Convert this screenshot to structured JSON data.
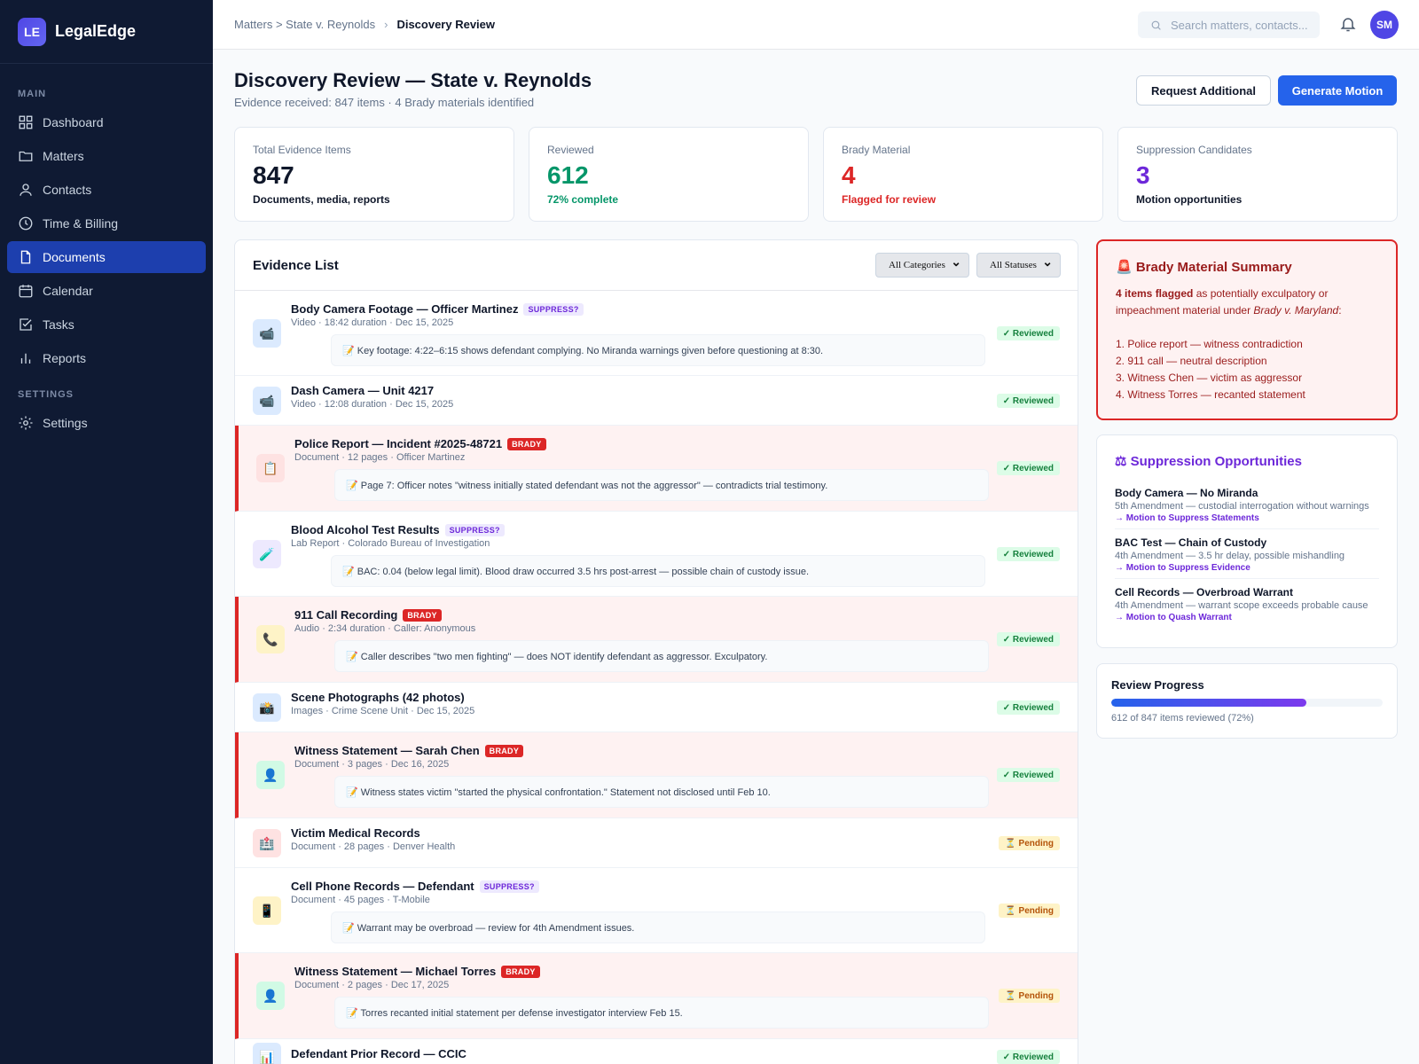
{
  "brand": {
    "logo": "LE",
    "name": "LegalEdge"
  },
  "sidebar": {
    "main_heading": "MAIN",
    "settings_heading": "SETTINGS",
    "items": [
      {
        "label": "Dashboard",
        "icon": "grid-icon"
      },
      {
        "label": "Matters",
        "icon": "folder-icon"
      },
      {
        "label": "Contacts",
        "icon": "user-icon"
      },
      {
        "label": "Time & Billing",
        "icon": "clock-icon"
      },
      {
        "label": "Documents",
        "icon": "document-icon",
        "active": true
      },
      {
        "label": "Calendar",
        "icon": "calendar-icon"
      },
      {
        "label": "Tasks",
        "icon": "checkbox-icon"
      },
      {
        "label": "Reports",
        "icon": "bar-chart-icon"
      }
    ],
    "settings_item": {
      "label": "Settings",
      "icon": "gear-icon"
    }
  },
  "topbar": {
    "breadcrumb_path": "Matters > State v. Reynolds",
    "breadcrumb_sep": "›",
    "breadcrumb_current": "Discovery Review",
    "search_placeholder": "Search matters, contacts...",
    "avatar_initials": "SM"
  },
  "header": {
    "title": "Discovery Review — State v. Reynolds",
    "subtitle": "Evidence received: 847 items · 4 Brady materials identified",
    "request_button": "Request Additional",
    "generate_button": "Generate Motion"
  },
  "stats": [
    {
      "label": "Total Evidence Items",
      "value": "847",
      "desc": "Documents, media, reports",
      "value_color": "#0f172a",
      "desc_color": "#0f172a"
    },
    {
      "label": "Reviewed",
      "value": "612",
      "desc": "72% complete",
      "value_color": "#059669",
      "desc_color": "#059669"
    },
    {
      "label": "Brady Material",
      "value": "4",
      "desc": "Flagged for review",
      "value_color": "#dc2626",
      "desc_color": "#dc2626"
    },
    {
      "label": "Suppression Candidates",
      "value": "3",
      "desc": "Motion opportunities",
      "value_color": "#6d28d9",
      "desc_color": "#0f172a"
    }
  ],
  "evidence": {
    "title": "Evidence List",
    "filter_category": "All Categories",
    "filter_status": "All Statuses",
    "rows": [
      {
        "title": "Body Camera Footage — Officer Martinez",
        "tag": "SUPPRESS?",
        "meta": "Video · 18:42 duration · Dec 15, 2025",
        "note": "📝 Key footage: 4:22–6:15 shows defendant complying. No Miranda warnings given before questioning at 8:30.",
        "status": "✓ Reviewed",
        "icon": "📹"
      },
      {
        "title": "Dash Camera — Unit 4217",
        "tag": "",
        "meta": "Video · 12:08 duration · Dec 15, 2025",
        "note": "",
        "status": "✓ Reviewed",
        "icon": "📹"
      },
      {
        "title": "Police Report — Incident #2025-48721",
        "tag": "BRADY",
        "meta": "Document · 12 pages · Officer Martinez",
        "note": "📝 Page 7: Officer notes \"witness initially stated defendant was not the aggressor\" — contradicts trial testimony.",
        "status": "✓ Reviewed",
        "icon": "📋"
      },
      {
        "title": "Blood Alcohol Test Results",
        "tag": "SUPPRESS?",
        "meta": "Lab Report · Colorado Bureau of Investigation",
        "note": "📝 BAC: 0.04 (below legal limit). Blood draw occurred 3.5 hrs post-arrest — possible chain of custody issue.",
        "status": "✓ Reviewed",
        "icon": "🧪"
      },
      {
        "title": "911 Call Recording",
        "tag": "BRADY",
        "meta": "Audio · 2:34 duration · Caller: Anonymous",
        "note": "📝 Caller describes \"two men fighting\" — does NOT identify defendant as aggressor. Exculpatory.",
        "status": "✓ Reviewed",
        "icon": "📞"
      },
      {
        "title": "Scene Photographs (42 photos)",
        "tag": "",
        "meta": "Images · Crime Scene Unit · Dec 15, 2025",
        "note": "",
        "status": "✓ Reviewed",
        "icon": "📸"
      },
      {
        "title": "Witness Statement — Sarah Chen",
        "tag": "BRADY",
        "meta": "Document · 3 pages · Dec 16, 2025",
        "note": "📝 Witness states victim \"started the physical confrontation.\" Statement not disclosed until Feb 10.",
        "status": "✓ Reviewed",
        "icon": "👤"
      },
      {
        "title": "Victim Medical Records",
        "tag": "",
        "meta": "Document · 28 pages · Denver Health",
        "note": "",
        "status": "⏳ Pending",
        "icon": "🏥"
      },
      {
        "title": "Cell Phone Records — Defendant",
        "tag": "SUPPRESS?",
        "meta": "Document · 45 pages · T-Mobile",
        "note": "📝 Warrant may be overbroad — review for 4th Amendment issues.",
        "status": "⏳ Pending",
        "icon": "📱"
      },
      {
        "title": "Witness Statement — Michael Torres",
        "tag": "BRADY",
        "meta": "Document · 2 pages · Dec 17, 2025",
        "note": "📝 Torres recanted initial statement per defense investigator interview Feb 15.",
        "status": "⏳ Pending",
        "icon": "👤"
      },
      {
        "title": "Defendant Prior Record — CCIC",
        "tag": "",
        "meta": "",
        "note": "",
        "status": "✓ Reviewed",
        "icon": "📊"
      }
    ]
  },
  "brady_summary": {
    "title": "🚨 Brady Material Summary",
    "lead_bold": "4 items flagged",
    "lead_text": " as potentially exculpatory or impeachment material under ",
    "lead_case": "Brady v. Maryland",
    "lead_end": ":",
    "items": [
      "1. Police report — witness contradiction",
      "2. 911 call — neutral description",
      "3. Witness Chen — victim as aggressor",
      "4. Witness Torres — recanted statement"
    ]
  },
  "suppression": {
    "title": "⚖ Suppression Opportunities",
    "items": [
      {
        "title": "Body Camera — No Miranda",
        "desc": "5th Amendment — custodial interrogation without warnings",
        "action": "→ Motion to Suppress Statements"
      },
      {
        "title": "BAC Test — Chain of Custody",
        "desc": "4th Amendment — 3.5 hr delay, possible mishandling",
        "action": "→ Motion to Suppress Evidence"
      },
      {
        "title": "Cell Records — Overbroad Warrant",
        "desc": "4th Amendment — warrant scope exceeds probable cause",
        "action": "→ Motion to Quash Warrant"
      }
    ]
  },
  "progress": {
    "title": "Review Progress",
    "fraction": 0.72,
    "text": "612 of 847 items reviewed (72%)"
  },
  "colors": {
    "accent": "#2563eb",
    "brady_red": "#dc2626",
    "suppress_purple": "#6d28d9",
    "reviewed_green": "#15803d",
    "pending_amber": "#b45309"
  }
}
